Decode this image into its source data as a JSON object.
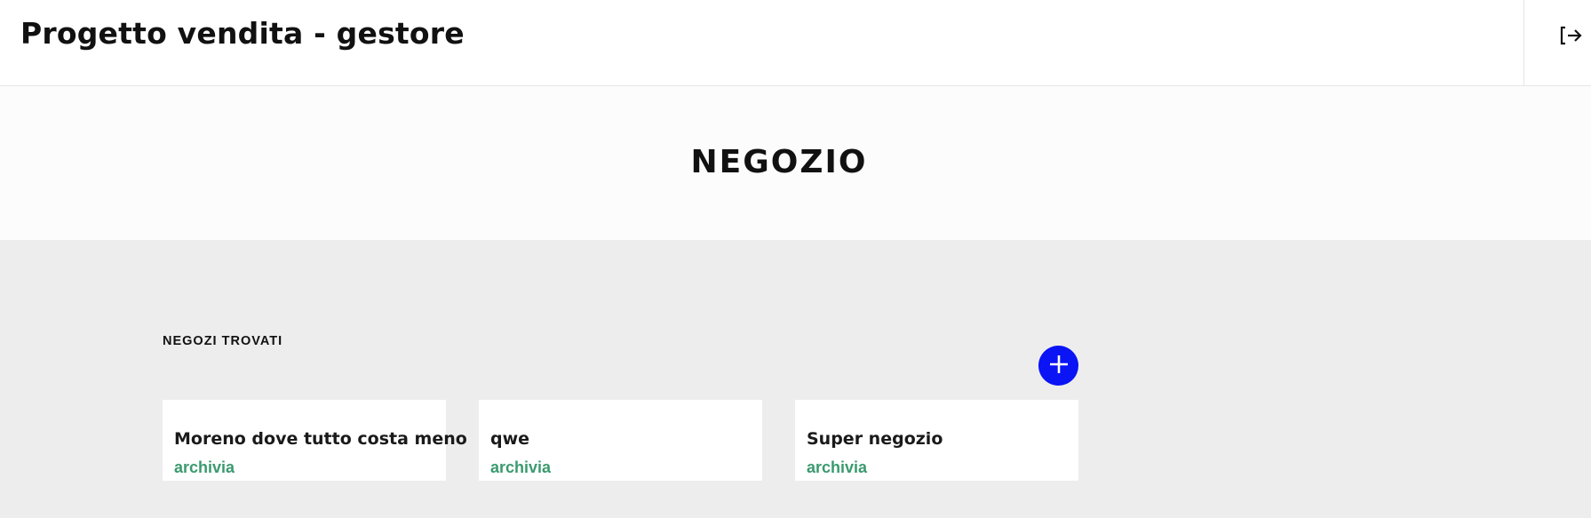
{
  "header": {
    "title": "Progetto vendita - gestore",
    "logout_icon": "logout-icon"
  },
  "hero": {
    "title": "NEGOZIO"
  },
  "stores": {
    "section_label": "NEGOZI TROVATI",
    "add_icon": "plus-icon",
    "accent_color": "#0a14f5",
    "action_color": "#3a9a6e",
    "items": [
      {
        "name": "Moreno dove tutto costa meno",
        "action": "archivia"
      },
      {
        "name": "qwe",
        "action": "archivia"
      },
      {
        "name": "Super negozio",
        "action": "archivia"
      }
    ]
  }
}
